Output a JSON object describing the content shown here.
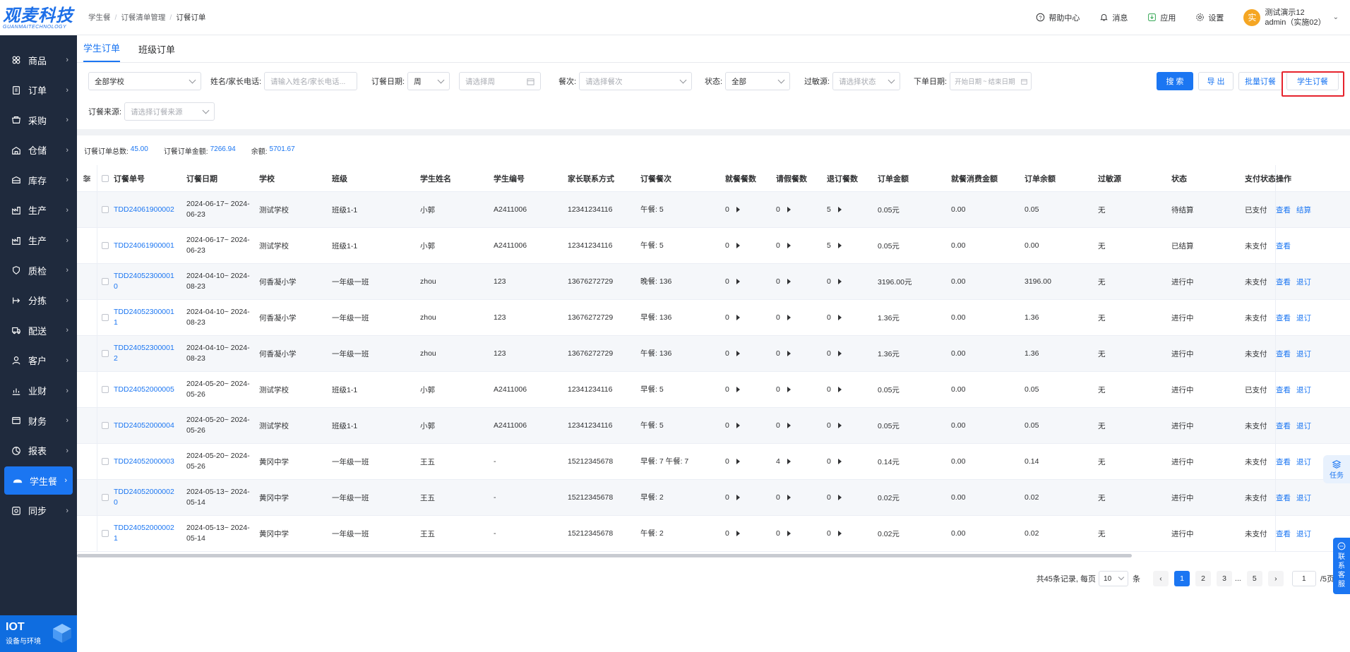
{
  "brand": {
    "name": "观麦科技",
    "sub": "GUANMAITECHNOLOGY"
  },
  "sidebar": {
    "items": [
      {
        "label": "商品",
        "icon": "product-icon"
      },
      {
        "label": "订单",
        "icon": "order-icon"
      },
      {
        "label": "采购",
        "icon": "purchase-icon"
      },
      {
        "label": "仓储",
        "icon": "warehouse-icon"
      },
      {
        "label": "库存",
        "icon": "inventory-icon"
      },
      {
        "label": "生产",
        "icon": "production-icon"
      },
      {
        "label": "生产",
        "icon": "production-icon"
      },
      {
        "label": "质检",
        "icon": "quality-icon"
      },
      {
        "label": "分拣",
        "icon": "sorting-icon"
      },
      {
        "label": "配送",
        "icon": "delivery-icon"
      },
      {
        "label": "客户",
        "icon": "customer-icon"
      },
      {
        "label": "业财",
        "icon": "business-finance-icon"
      },
      {
        "label": "财务",
        "icon": "finance-icon"
      },
      {
        "label": "报表",
        "icon": "report-icon"
      },
      {
        "label": "学生餐",
        "icon": "student-meal-icon",
        "active": true
      },
      {
        "label": "同步",
        "icon": "sync-icon"
      }
    ],
    "iot": {
      "title": "IOT",
      "subtitle": "设备与环境"
    }
  },
  "header": {
    "breadcrumb": [
      "学生餐",
      "订餐清单管理",
      "订餐订单"
    ],
    "help": "帮助中心",
    "messages": "消息",
    "apps": "应用",
    "settings": "设置",
    "avatar": "实",
    "user_name": "测试演示12",
    "user_account": "admin（实施02）"
  },
  "tabs": [
    "学生订单",
    "班级订单"
  ],
  "filters": {
    "school": "全部学校",
    "name_label": "姓名/家长电话:",
    "name_placeholder": "请输入姓名/家长电话...",
    "date_label": "订餐日期:",
    "date_unit": "周",
    "week_placeholder": "请选择周",
    "meal_label": "餐次:",
    "meal_placeholder": "请选择餐次",
    "status_label": "状态:",
    "status_value": "全部",
    "allergen_label": "过敏源:",
    "allergen_placeholder": "请选择状态",
    "order_date_label": "下单日期:",
    "order_date_start": "开始日期",
    "order_date_sep": "~",
    "order_date_end": "结束日期",
    "source_label": "订餐来源:",
    "source_placeholder": "请选择订餐来源"
  },
  "buttons": {
    "search": "搜 索",
    "export": "导 出",
    "batch": "批量订餐",
    "student_order": "学生订餐"
  },
  "summary": {
    "total_label": "订餐订单总数:",
    "total": "45.00",
    "amount_label": "订餐订单金额:",
    "amount": "7266.94",
    "balance_label": "余额:",
    "balance": "5701.67"
  },
  "table": {
    "columns": [
      "订餐单号",
      "订餐日期",
      "学校",
      "班级",
      "学生姓名",
      "学生编号",
      "家长联系方式",
      "订餐餐次",
      "就餐餐数",
      "请假餐数",
      "退订餐数",
      "订单金额",
      "就餐消费金额",
      "订单余额",
      "过敏源",
      "状态",
      "支付状态",
      "操作"
    ],
    "rows": [
      {
        "no": "TDD24061900002",
        "date": "2024-06-17~ 2024-06-23",
        "school": "测试学校",
        "cls": "班级1-1",
        "name": "小郭",
        "sid": "A2411006",
        "phone": "12341234116",
        "meal": "午餐: 5",
        "eat": "0",
        "leave": "0",
        "cancel": "5",
        "amount": "0.05元",
        "consume": "0.00",
        "balance": "0.05",
        "allergen": "无",
        "status": "待结算",
        "pay": "已支付",
        "ops": [
          "查看",
          "结算"
        ]
      },
      {
        "no": "TDD24061900001",
        "date": "2024-06-17~ 2024-06-23",
        "school": "测试学校",
        "cls": "班级1-1",
        "name": "小郭",
        "sid": "A2411006",
        "phone": "12341234116",
        "meal": "午餐: 5",
        "eat": "0",
        "leave": "0",
        "cancel": "5",
        "amount": "0.05元",
        "consume": "0.00",
        "balance": "0.00",
        "allergen": "无",
        "status": "已结算",
        "pay": "未支付",
        "ops": [
          "查看"
        ]
      },
      {
        "no": "TDD240523000010",
        "date": "2024-04-10~ 2024-08-23",
        "school": "何香凝小学",
        "cls": "一年级一班",
        "name": "zhou",
        "sid": "123",
        "phone": "13676272729",
        "meal": "晚餐: 136",
        "eat": "0",
        "leave": "0",
        "cancel": "0",
        "amount": "3196.00元",
        "consume": "0.00",
        "balance": "3196.00",
        "allergen": "无",
        "status": "进行中",
        "pay": "未支付",
        "ops": [
          "查看",
          "退订"
        ]
      },
      {
        "no": "TDD240523000011",
        "date": "2024-04-10~ 2024-08-23",
        "school": "何香凝小学",
        "cls": "一年级一班",
        "name": "zhou",
        "sid": "123",
        "phone": "13676272729",
        "meal": "早餐: 136",
        "eat": "0",
        "leave": "0",
        "cancel": "0",
        "amount": "1.36元",
        "consume": "0.00",
        "balance": "1.36",
        "allergen": "无",
        "status": "进行中",
        "pay": "未支付",
        "ops": [
          "查看",
          "退订"
        ]
      },
      {
        "no": "TDD240523000012",
        "date": "2024-04-10~ 2024-08-23",
        "school": "何香凝小学",
        "cls": "一年级一班",
        "name": "zhou",
        "sid": "123",
        "phone": "13676272729",
        "meal": "午餐: 136",
        "eat": "0",
        "leave": "0",
        "cancel": "0",
        "amount": "1.36元",
        "consume": "0.00",
        "balance": "1.36",
        "allergen": "无",
        "status": "进行中",
        "pay": "未支付",
        "ops": [
          "查看",
          "退订"
        ]
      },
      {
        "no": "TDD24052000005",
        "date": "2024-05-20~ 2024-05-26",
        "school": "测试学校",
        "cls": "班级1-1",
        "name": "小郭",
        "sid": "A2411006",
        "phone": "12341234116",
        "meal": "早餐: 5",
        "eat": "0",
        "leave": "0",
        "cancel": "0",
        "amount": "0.05元",
        "consume": "0.00",
        "balance": "0.05",
        "allergen": "无",
        "status": "进行中",
        "pay": "已支付",
        "ops": [
          "查看",
          "退订"
        ]
      },
      {
        "no": "TDD24052000004",
        "date": "2024-05-20~ 2024-05-26",
        "school": "测试学校",
        "cls": "班级1-1",
        "name": "小郭",
        "sid": "A2411006",
        "phone": "12341234116",
        "meal": "午餐: 5",
        "eat": "0",
        "leave": "0",
        "cancel": "0",
        "amount": "0.05元",
        "consume": "0.00",
        "balance": "0.05",
        "allergen": "无",
        "status": "进行中",
        "pay": "未支付",
        "ops": [
          "查看",
          "退订"
        ]
      },
      {
        "no": "TDD24052000003",
        "date": "2024-05-20~ 2024-05-26",
        "school": "黄冈中学",
        "cls": "一年级一班",
        "name": "王五",
        "sid": "-",
        "phone": "15212345678",
        "meal": "早餐: 7 午餐: 7",
        "eat": "0",
        "leave": "4",
        "cancel": "0",
        "amount": "0.14元",
        "consume": "0.00",
        "balance": "0.14",
        "allergen": "无",
        "status": "进行中",
        "pay": "未支付",
        "ops": [
          "查看",
          "退订"
        ]
      },
      {
        "no": "TDD240520000020",
        "date": "2024-05-13~ 2024-05-14",
        "school": "黄冈中学",
        "cls": "一年级一班",
        "name": "王五",
        "sid": "-",
        "phone": "15212345678",
        "meal": "早餐: 2",
        "eat": "0",
        "leave": "0",
        "cancel": "0",
        "amount": "0.02元",
        "consume": "0.00",
        "balance": "0.02",
        "allergen": "无",
        "status": "进行中",
        "pay": "未支付",
        "ops": [
          "查看",
          "退订"
        ]
      },
      {
        "no": "TDD240520000021",
        "date": "2024-05-13~ 2024-05-14",
        "school": "黄冈中学",
        "cls": "一年级一班",
        "name": "王五",
        "sid": "-",
        "phone": "15212345678",
        "meal": "午餐: 2",
        "eat": "0",
        "leave": "0",
        "cancel": "0",
        "amount": "0.02元",
        "consume": "0.00",
        "balance": "0.02",
        "allergen": "无",
        "status": "进行中",
        "pay": "未支付",
        "ops": [
          "查看",
          "退订"
        ]
      }
    ]
  },
  "pagination": {
    "total_text": "共45条记录, 每页",
    "page_size": "10",
    "unit": "条",
    "pages": [
      "1",
      "2",
      "3",
      "...",
      "5"
    ],
    "current": "1",
    "jump_value": "1",
    "total_pages": "/5页"
  },
  "floating": {
    "task": "任务",
    "service": [
      "联",
      "系",
      "客",
      "服"
    ]
  },
  "colors": {
    "primary": "#1b76f2",
    "sidebar": "#1f2a3d",
    "highlight": "#e6232d"
  }
}
